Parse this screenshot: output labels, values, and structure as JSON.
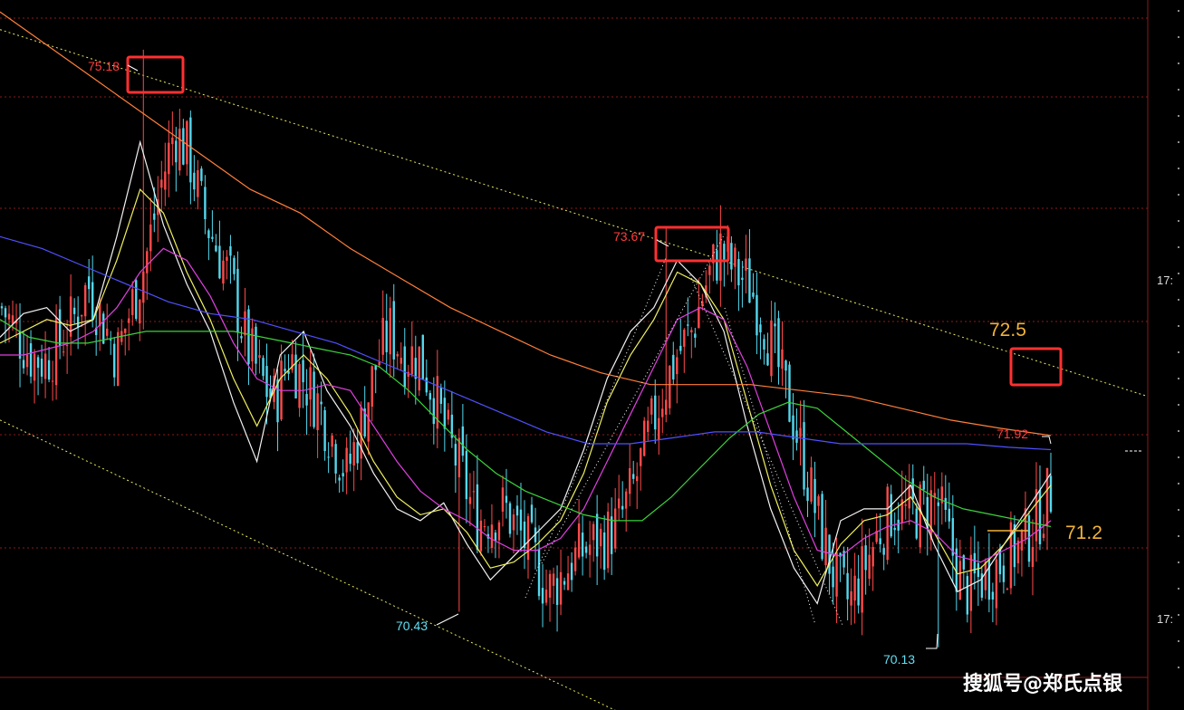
{
  "chart_data": {
    "type": "candlestick",
    "ylim": [
      69.6,
      75.6
    ],
    "colors": {
      "up": "#ff4a4a",
      "down": "#54d8ee",
      "ma_white": "#f2f2f2",
      "ma_yellow": "#f0f060",
      "ma_magenta": "#e040e0",
      "ma_green": "#3bd23b",
      "ma_blue": "#5050ff",
      "ma_orange": "#ff7f3a",
      "channel": "#e8e860",
      "grid": "#8b1a1a",
      "highlight_box": "#ff3030",
      "annotation_amber": "#f2b33a"
    },
    "close_path": [
      73.0,
      72.8,
      72.6,
      72.55,
      72.7,
      72.9,
      73.2,
      72.9,
      72.6,
      73.0,
      73.4,
      74.0,
      74.5,
      74.3,
      73.8,
      73.5,
      73.2,
      72.7,
      72.4,
      72.2,
      72.6,
      72.4,
      72.2,
      71.9,
      71.6,
      72.0,
      72.5,
      72.8,
      72.6,
      72.6,
      72.3,
      71.9,
      71.6,
      71.2,
      71.25,
      71.3,
      71.1,
      70.9,
      70.6,
      70.75,
      70.9,
      71.0,
      71.05,
      71.2,
      71.5,
      71.9,
      72.3,
      72.6,
      72.8,
      73.2,
      73.5,
      73.3,
      73.2,
      72.9,
      72.5,
      72.1,
      71.6,
      71.1,
      70.7,
      70.5,
      70.8,
      71.1,
      71.3,
      71.25,
      71.3,
      71.4,
      71.0,
      70.6,
      70.7,
      70.8,
      70.9,
      71.0,
      71.2,
      71.45
    ],
    "moving_averages": [
      {
        "key": "ma_white",
        "values": [
          72.75,
          72.95,
          73.0,
          72.8,
          72.9,
          73.6,
          74.4,
          73.7,
          73.2,
          72.8,
          72.2,
          71.7,
          72.6,
          72.8,
          72.3,
          72.0,
          71.6,
          71.3,
          71.2,
          71.35,
          71.0,
          70.7,
          70.9,
          71.1,
          71.3,
          71.8,
          72.4,
          72.8,
          73.0,
          73.4,
          73.2,
          72.8,
          72.0,
          71.3,
          70.8,
          70.5,
          71.2,
          71.3,
          71.3,
          71.5,
          71.0,
          70.6,
          70.7,
          71.0,
          71.3,
          71.6
        ]
      },
      {
        "key": "ma_yellow",
        "values": [
          72.7,
          72.8,
          72.9,
          72.85,
          72.9,
          73.4,
          74.0,
          73.8,
          73.3,
          72.9,
          72.4,
          72.0,
          72.4,
          72.6,
          72.4,
          72.1,
          71.7,
          71.4,
          71.25,
          71.3,
          71.1,
          70.8,
          70.85,
          71.0,
          71.2,
          71.6,
          72.2,
          72.6,
          72.9,
          73.3,
          73.2,
          72.9,
          72.2,
          71.5,
          70.95,
          70.65,
          71.0,
          71.2,
          71.25,
          71.4,
          71.1,
          70.75,
          70.8,
          71.0,
          71.25,
          71.5
        ]
      },
      {
        "key": "ma_magenta",
        "values": [
          72.6,
          72.6,
          72.65,
          72.7,
          72.8,
          73.0,
          73.3,
          73.5,
          73.4,
          73.1,
          72.7,
          72.4,
          72.3,
          72.3,
          72.35,
          72.3,
          72.0,
          71.7,
          71.45,
          71.3,
          71.2,
          71.05,
          70.95,
          70.95,
          71.05,
          71.3,
          71.7,
          72.1,
          72.5,
          72.9,
          73.0,
          72.9,
          72.5,
          71.95,
          71.4,
          70.95,
          70.9,
          71.05,
          71.15,
          71.2,
          71.1,
          70.9,
          70.85,
          70.95,
          71.05,
          71.2
        ]
      },
      {
        "key": "ma_green",
        "values": [
          72.9,
          72.75,
          72.7,
          72.7,
          72.75,
          72.8,
          72.8,
          72.8,
          72.8,
          72.75,
          72.7,
          72.65,
          72.6,
          72.5,
          72.3,
          72.05,
          71.8,
          71.6,
          71.45,
          71.35,
          71.25,
          71.2,
          71.2,
          71.4,
          71.65,
          71.9,
          72.1,
          72.2,
          72.15,
          71.95,
          71.75,
          71.55,
          71.4,
          71.3,
          71.25,
          71.2,
          71.15
        ]
      },
      {
        "key": "ma_blue",
        "values": [
          73.6,
          73.5,
          73.35,
          73.2,
          73.05,
          72.95,
          72.9,
          72.8,
          72.7,
          72.55,
          72.4,
          72.25,
          72.1,
          71.95,
          71.85,
          71.85,
          71.9,
          71.95,
          71.95,
          71.9,
          71.85,
          71.85,
          71.85,
          71.85,
          71.82,
          71.8
        ]
      },
      {
        "key": "ma_orange",
        "values": [
          75.5,
          75.2,
          74.9,
          74.6,
          74.3,
          74.0,
          73.8,
          73.5,
          73.25,
          73.0,
          72.8,
          72.6,
          72.45,
          72.35,
          72.35,
          72.35,
          72.3,
          72.25,
          72.15,
          72.05,
          71.98,
          71.92
        ]
      }
    ],
    "channel_upper": {
      "x": [
        0,
        1267
      ],
      "y": [
        75.35,
        72.25
      ]
    },
    "channel_lower": {
      "x": [
        0,
        720
      ],
      "y": [
        72.05,
        69.45
      ]
    },
    "price_labels": [
      {
        "text": "75.18",
        "value": 75.18
      },
      {
        "text": "73.67",
        "value": 73.67
      },
      {
        "text": "71.92",
        "value": 71.92
      },
      {
        "text": "70.43",
        "value": 70.43
      },
      {
        "text": "70.13",
        "value": 70.13
      }
    ],
    "annotations": [
      {
        "text": "72.5",
        "value": 72.5
      },
      {
        "text": "71.2",
        "value": 71.2
      }
    ],
    "time_axis_fragments": [
      "17:",
      "17:"
    ],
    "watermark": "搜狐号@郑氏点银"
  }
}
